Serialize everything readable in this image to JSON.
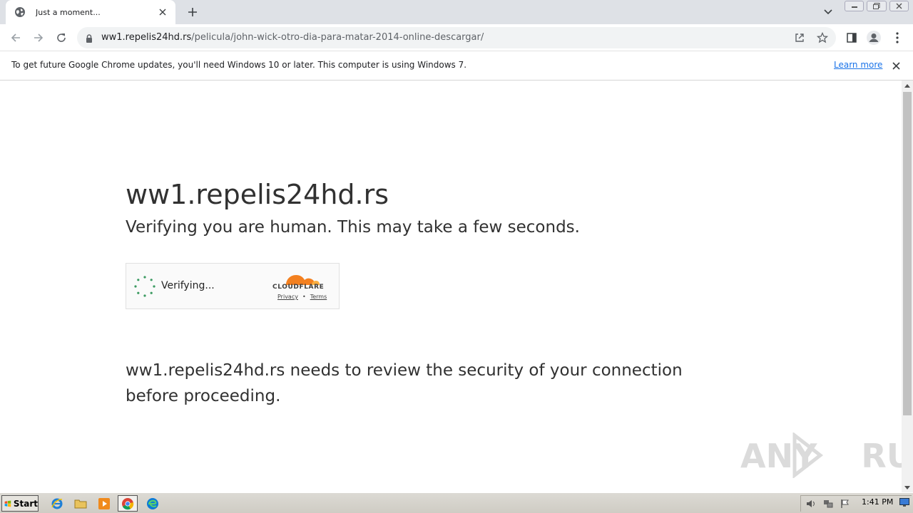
{
  "browser": {
    "tab": {
      "title": "Just a moment...",
      "favicon": "globe-icon"
    },
    "toolbar": {
      "url_host": "ww1.repelis24hd.rs",
      "url_path": "/pelicula/john-wick-otro-dia-para-matar-2014-online-descargar/"
    },
    "infobar": {
      "message": "To get future Google Chrome updates, you'll need Windows 10 or later. This computer is using Windows 7.",
      "link": "Learn more"
    }
  },
  "page": {
    "site_title": "ww1.repelis24hd.rs",
    "subtitle": "Verifying you are human. This may take a few seconds.",
    "widget": {
      "status": "Verifying...",
      "brand": "CLOUDFLARE",
      "privacy": "Privacy",
      "separator": "•",
      "terms": "Terms",
      "brand_color": "#f38020"
    },
    "review": "ww1.repelis24hd.rs needs to review the security of your connection before proceeding."
  },
  "watermark": {
    "text": "ANY RUN"
  },
  "taskbar": {
    "start": "Start",
    "clock": "1:41 PM",
    "apps": [
      "internet-explorer-icon",
      "folder-icon",
      "media-player-icon",
      "chrome-icon",
      "edge-icon"
    ]
  },
  "colors": {
    "accent_link": "#1a73e8",
    "text_dark": "#313131",
    "spinner_green": "#3b9a61"
  }
}
